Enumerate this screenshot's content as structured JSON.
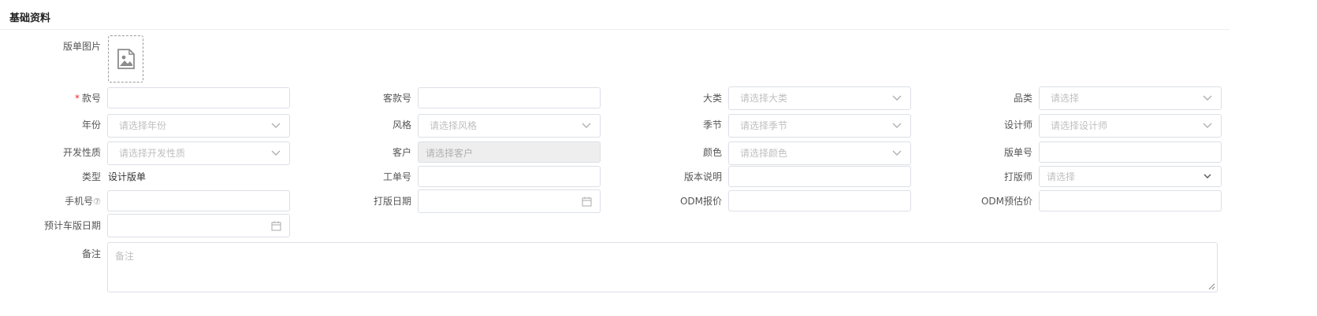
{
  "section": {
    "title": "基础资料"
  },
  "upload": {
    "label": "版单图片",
    "icon": "image-upload-icon"
  },
  "fields": {
    "style_no": {
      "label": "款号",
      "required_mark": "*",
      "value": ""
    },
    "customer_style_no": {
      "label": "客款号",
      "value": ""
    },
    "category_major": {
      "label": "大类",
      "placeholder": "请选择大类"
    },
    "category": {
      "label": "品类",
      "placeholder": "请选择"
    },
    "year": {
      "label": "年份",
      "placeholder": "请选择年份"
    },
    "style": {
      "label": "风格",
      "placeholder": "请选择风格"
    },
    "season": {
      "label": "季节",
      "placeholder": "请选择季节"
    },
    "designer": {
      "label": "设计师",
      "placeholder": "请选择设计师"
    },
    "dev_nature": {
      "label": "开发性质",
      "placeholder": "请选择开发性质"
    },
    "customer": {
      "label": "客户",
      "placeholder": "请选择客户"
    },
    "color": {
      "label": "颜色",
      "placeholder": "请选择颜色"
    },
    "pattern_no": {
      "label": "版单号",
      "value": ""
    },
    "type": {
      "label": "类型",
      "value": "设计版单"
    },
    "work_order_no": {
      "label": "工单号",
      "value": ""
    },
    "version_note": {
      "label": "版本说明",
      "value": ""
    },
    "pattern_maker": {
      "label": "打版师",
      "placeholder": "请选择"
    },
    "phone": {
      "label": "手机号",
      "help_icon": "⑦",
      "value": ""
    },
    "sample_date": {
      "label": "打版日期",
      "value": ""
    },
    "odm_quote": {
      "label": "ODM报价",
      "value": ""
    },
    "odm_estimate": {
      "label": "ODM预估价",
      "value": ""
    },
    "planned_date": {
      "label": "预计车版日期",
      "value": ""
    },
    "remark": {
      "label": "备注",
      "placeholder": "备注"
    }
  }
}
